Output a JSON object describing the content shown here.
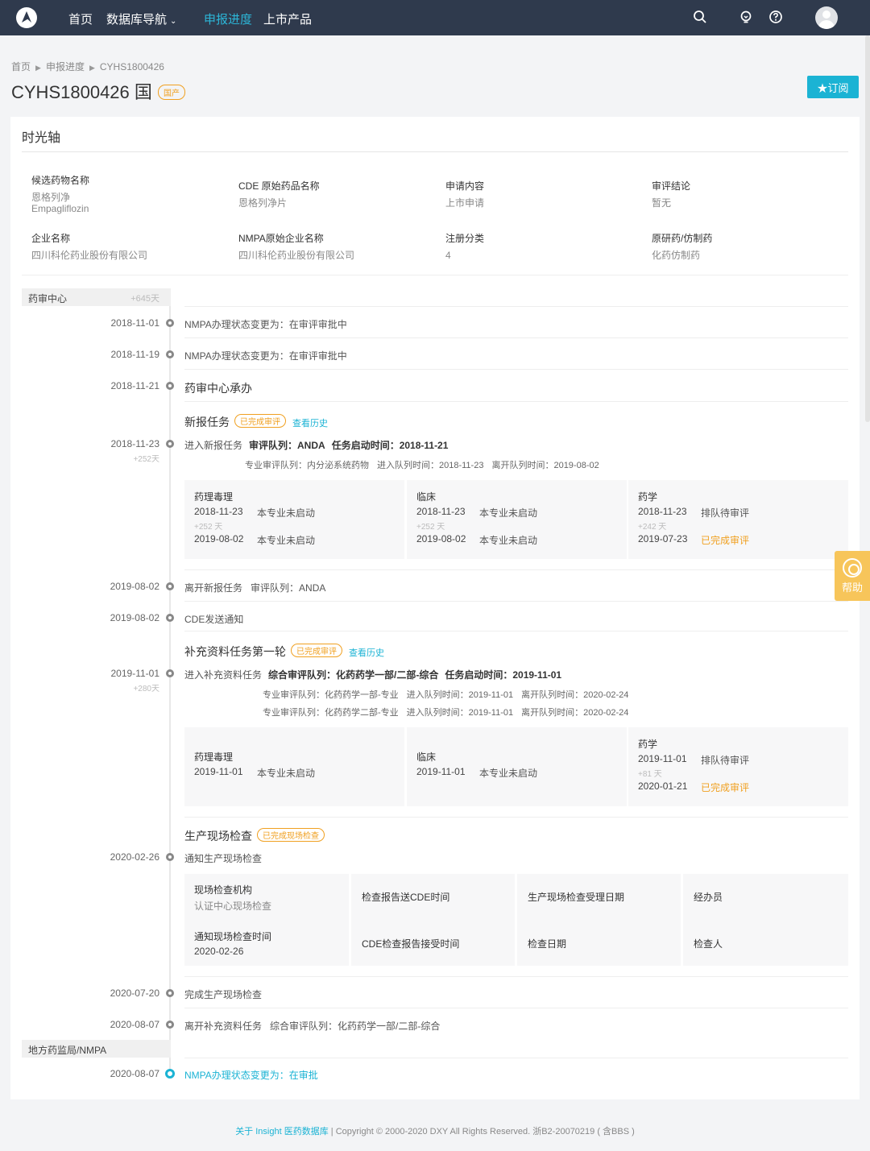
{
  "nav": {
    "items": [
      "首页",
      "数据库导航",
      "申报进度",
      "上市产品"
    ],
    "caret": "⌄"
  },
  "breadcrumb": [
    "首页",
    "申报进度",
    "CYHS1800426"
  ],
  "header": {
    "title": "CYHS1800426 国",
    "badge": "国产",
    "subscribe": "★订阅"
  },
  "card": {
    "title": "时光轴",
    "info": [
      {
        "k": "候选药物名称",
        "v1": "恩格列净",
        "v2": "Empagliflozin"
      },
      {
        "k": "CDE 原始药品名称",
        "v1": "恩格列净片",
        "v2": ""
      },
      {
        "k": "申请内容",
        "v1": "上市申请",
        "v2": ""
      },
      {
        "k": "审评结论",
        "v1": "暂无",
        "v2": ""
      },
      {
        "k": "企业名称",
        "v1": "四川科伦药业股份有限公司",
        "v2": ""
      },
      {
        "k": "NMPA原始企业名称",
        "v1": "四川科伦药业股份有限公司",
        "v2": ""
      },
      {
        "k": "注册分类",
        "v1": "4",
        "v2": ""
      },
      {
        "k": "原研药/仿制药",
        "v1": "化药仿制药",
        "v2": ""
      }
    ]
  },
  "timeline": {
    "section1": {
      "label": "药审中心",
      "days": "+645天"
    },
    "section2": {
      "label": "地方药监局/NMPA"
    },
    "e1": {
      "date": "2018-11-01",
      "text": "NMPA办理状态变更为：在审评审批中"
    },
    "e2": {
      "date": "2018-11-19",
      "text": "NMPA办理状态变更为：在审评审批中"
    },
    "e3": {
      "date": "2018-11-21",
      "text": "药审中心承办"
    },
    "task1": {
      "title": "新报任务",
      "status": "已完成审评",
      "history": "查看历史",
      "date": "2018-11-23",
      "days": "+252天",
      "enter": "进入新报任务",
      "queue": "审评队列：ANDA",
      "start": "任务启动时间：2018-11-21",
      "sub": [
        "专业审评队列：内分泌系统药物",
        "进入队列时间：2018-11-23",
        "离开队列时间：2019-08-02"
      ],
      "panels": [
        {
          "h": "药理毒理",
          "d1": "2018-11-23",
          "s1": "本专业未启动",
          "dd": "+252 天",
          "d2": "2019-08-02",
          "s2": "本专业未启动"
        },
        {
          "h": "临床",
          "d1": "2018-11-23",
          "s1": "本专业未启动",
          "dd": "+252 天",
          "d2": "2019-08-02",
          "s2": "本专业未启动"
        },
        {
          "h": "药学",
          "d1": "2018-11-23",
          "s1": "排队待审评",
          "dd": "+242 天",
          "d2": "2019-07-23",
          "s2": "已完成审评"
        }
      ]
    },
    "e4": {
      "date": "2019-08-02",
      "text": "离开新报任务",
      "extra": "审评队列：ANDA"
    },
    "e5": {
      "date": "2019-08-02",
      "text": "CDE发送通知"
    },
    "task2": {
      "title": "补充资料任务第一轮",
      "status": "已完成审评",
      "history": "查看历史",
      "date": "2019-11-01",
      "days": "+280天",
      "enter": "进入补充资料任务",
      "queue": "综合审评队列：化药药学一部/二部-综合",
      "start": "任务启动时间：2019-11-01",
      "sub1": [
        "专业审评队列：化药药学一部-专业",
        "进入队列时间：2019-11-01",
        "离开队列时间：2020-02-24"
      ],
      "sub2": [
        "专业审评队列：化药药学二部-专业",
        "进入队列时间：2019-11-01",
        "离开队列时间：2020-02-24"
      ],
      "panels": [
        {
          "h": "药理毒理",
          "d1": "2019-11-01",
          "s1": "本专业未启动"
        },
        {
          "h": "临床",
          "d1": "2019-11-01",
          "s1": "本专业未启动"
        },
        {
          "h": "药学",
          "d1": "2019-11-01",
          "s1": "排队待审评",
          "dd": "+81 天",
          "d2": "2020-01-21",
          "s2": "已完成审评"
        }
      ]
    },
    "task3": {
      "title": "生产现场检查",
      "status": "已完成现场检查",
      "date": "2020-02-26",
      "text": "通知生产现场检查",
      "fields": {
        "org_k": "现场检查机构",
        "org_v": "认证中心现场检查",
        "notify_k": "通知现场检查时间",
        "notify_v": "2020-02-26",
        "report_send": "检查报告送CDE时间",
        "report_recv": "CDE检查报告接受时间",
        "accept_date": "生产现场检查受理日期",
        "check_date": "检查日期",
        "handler": "经办员",
        "inspector": "检查人"
      }
    },
    "e6": {
      "date": "2020-07-20",
      "text": "完成生产现场检查"
    },
    "e7": {
      "date": "2020-08-07",
      "text": "离开补充资料任务",
      "extra": "综合审评队列：化药药学一部/二部-综合"
    },
    "e8": {
      "date": "2020-08-07",
      "text": "NMPA办理状态变更为：在审批"
    }
  },
  "help": {
    "label": "帮助"
  },
  "footer": {
    "link": "关于 Insight 医药数据库",
    "text": " | Copyright © 2000-2020 DXY All Rights Reserved. 浙B2-20070219 ( 含BBS )"
  },
  "colors": {
    "accent": "#1bb3d4",
    "nav_bg": "#2f3a4d",
    "status": "#f0a020",
    "help": "#f7c55a"
  },
  "icons": [
    "logo-icon",
    "search-icon",
    "bulb-icon",
    "help-circle-icon",
    "avatar",
    "help-float-icon"
  ]
}
